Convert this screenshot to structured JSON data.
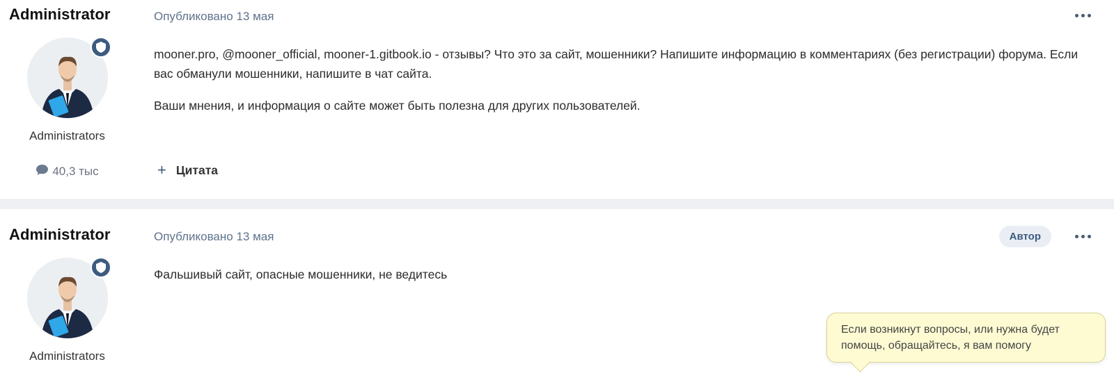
{
  "posts": [
    {
      "author": "Administrator",
      "group": "Administrators",
      "count": "40,3 тыс",
      "date": "Опубликовано 13 мая",
      "paragraphs": [
        "mooner.pro, @mooner_official, mooner-1.gitbook.io - отзывы? Что это за сайт, мошенники? Напишите информацию в комментариях (без регистрации) форума. Если вас обманули мошенники, напишите в чат сайта.",
        "Ваши мнения, и информация о сайте может быть полезна для других пользователей."
      ],
      "quote_label": "Цитата"
    },
    {
      "author": "Administrator",
      "group": "Administrators",
      "date": "Опубликовано 13 мая",
      "author_tag": "Автор",
      "paragraphs": [
        "Фальшивый сайт, опасные мошенники, не ведитесь"
      ]
    }
  ],
  "tooltip": {
    "text": "Если возникнут вопросы, или нужна будет помощь, обращайтесь, я вам помогу"
  },
  "colors": {
    "accent": "#3d5b7f",
    "tooltip_bg": "#fefbd3",
    "separator": "#eef0f4"
  },
  "icons": [
    "shield-icon",
    "comment-icon",
    "more-icon",
    "plus-icon"
  ]
}
